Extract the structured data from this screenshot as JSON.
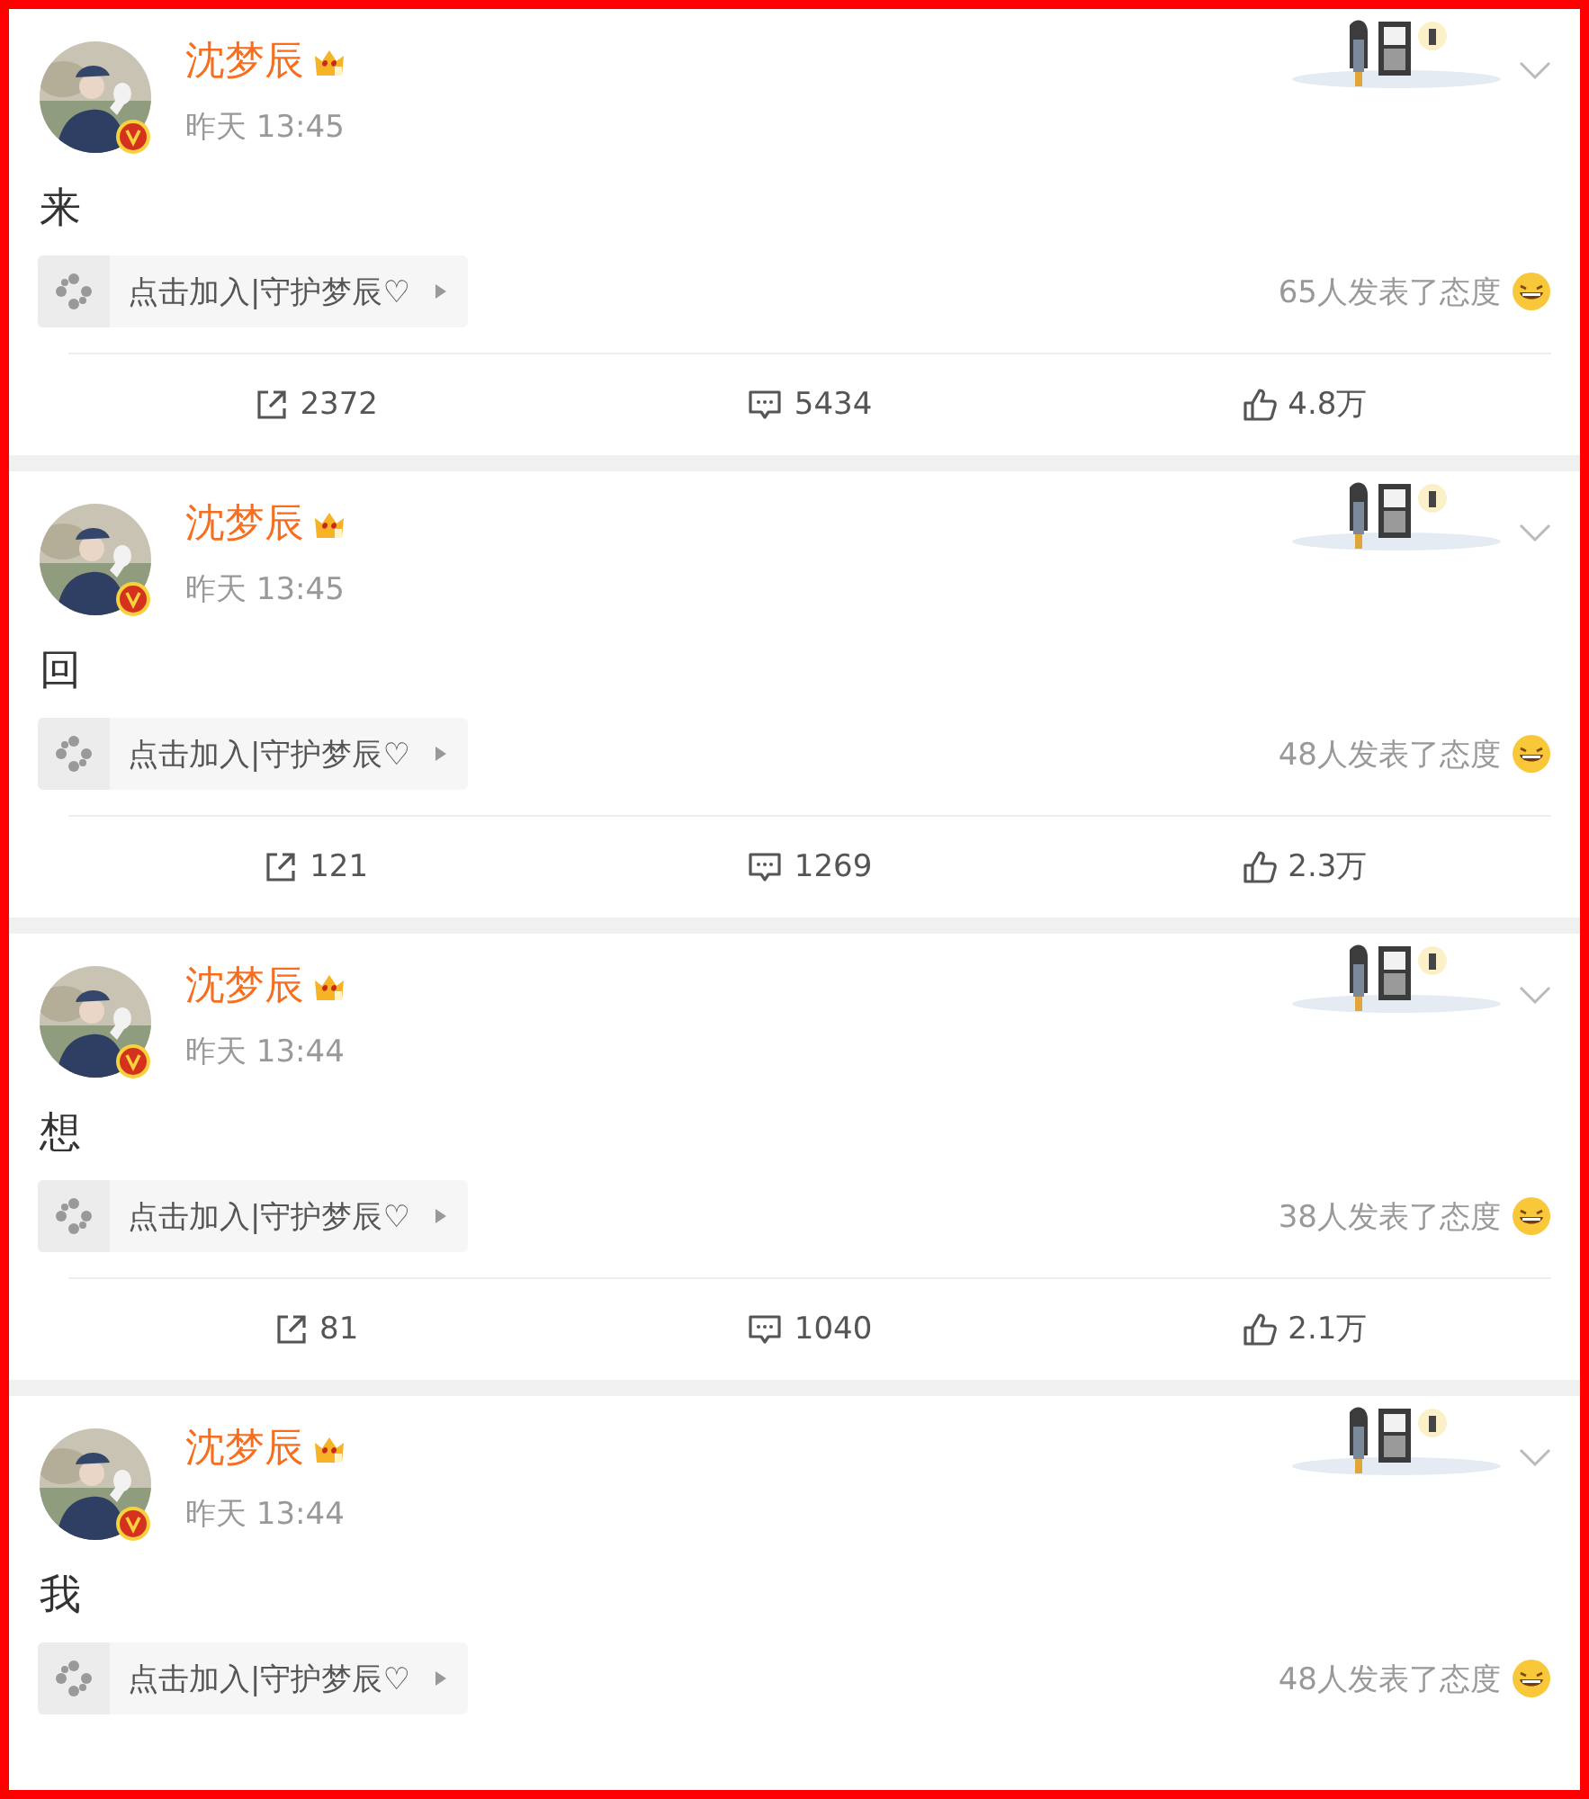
{
  "posts": [
    {
      "author": "沈梦辰",
      "time": "昨天 13:45",
      "text": "来",
      "topic": "点击加入|守护梦辰♡",
      "reactions": "65人发表了态度",
      "actions": [
        {
          "kind": "repost",
          "count": "2372"
        },
        {
          "kind": "comment",
          "count": "5434"
        },
        {
          "kind": "like",
          "count": "4.8万"
        }
      ]
    },
    {
      "author": "沈梦辰",
      "time": "昨天 13:45",
      "text": "回",
      "topic": "点击加入|守护梦辰♡",
      "reactions": "48人发表了态度",
      "actions": [
        {
          "kind": "repost",
          "count": "121"
        },
        {
          "kind": "comment",
          "count": "1269"
        },
        {
          "kind": "like",
          "count": "2.3万"
        }
      ]
    },
    {
      "author": "沈梦辰",
      "time": "昨天 13:44",
      "text": "想",
      "topic": "点击加入|守护梦辰♡",
      "reactions": "38人发表了态度",
      "actions": [
        {
          "kind": "repost",
          "count": "81"
        },
        {
          "kind": "comment",
          "count": "1040"
        },
        {
          "kind": "like",
          "count": "2.1万"
        }
      ]
    },
    {
      "author": "沈梦辰",
      "time": "昨天 13:44",
      "text": "我",
      "topic": "点击加入|守护梦辰♡",
      "reactions": "48人发表了态度"
    }
  ]
}
